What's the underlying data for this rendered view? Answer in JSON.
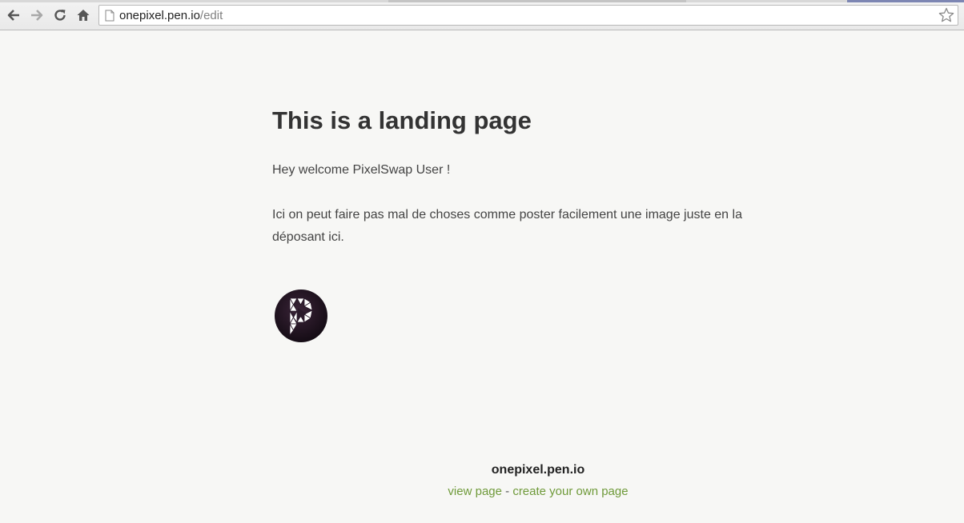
{
  "browser": {
    "url_host": "onepixel.pen.io",
    "url_path": "/edit",
    "icons": [
      "back-icon",
      "forward-icon",
      "reload-icon",
      "home-icon",
      "page-icon",
      "star-icon"
    ]
  },
  "page": {
    "title": "This is a landing page",
    "paragraph_1": "Hey welcome PixelSwap User !",
    "paragraph_2": "Ici on peut faire pas mal de choses comme poster facilement une image juste en la déposant ici."
  },
  "footer": {
    "site_name": "onepixel.pen.io",
    "view_link": "view page",
    "separator": " - ",
    "create_link": "create your own page"
  },
  "colors": {
    "background": "#f7f7f5",
    "heading": "#333333",
    "body_text": "#444444",
    "link": "#6f9a3a",
    "logo_dark": "#2a1a2a"
  }
}
